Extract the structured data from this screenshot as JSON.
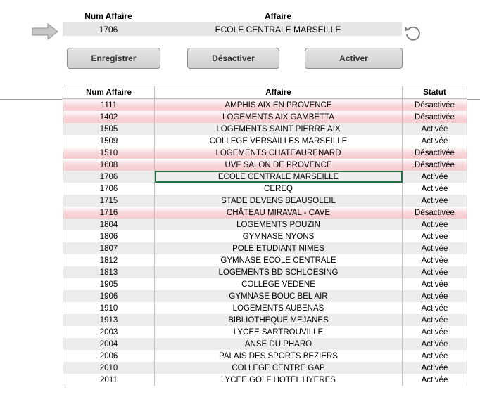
{
  "header": {
    "num_label": "Num Affaire",
    "affaire_label": "Affaire",
    "selected_num": "1706",
    "selected_affaire": "ECOLE CENTRALE MARSEILLE"
  },
  "icons": {
    "arrow": "arrow-right-icon",
    "refresh": "refresh-icon"
  },
  "buttons": {
    "save": "Enregistrer",
    "deactivate": "Désactiver",
    "activate": "Activer"
  },
  "colors": {
    "row_shade": "#ececec",
    "deactivated_tint": "#f6cbd0",
    "selection": "#217346"
  },
  "table": {
    "columns": [
      "Num Affaire",
      "Affaire",
      "Statut"
    ],
    "selected_row": 6,
    "rows": [
      {
        "num": "1111",
        "affaire": "AMPHIS AIX EN PROVENCE",
        "statut": "Désactivée"
      },
      {
        "num": "1402",
        "affaire": "LOGEMENTS AIX GAMBETTA",
        "statut": "Désactivée"
      },
      {
        "num": "1505",
        "affaire": "LOGEMENTS SAINT PIERRE AIX",
        "statut": "Activée"
      },
      {
        "num": "1509",
        "affaire": "COLLEGE VERSAILLES MARSEILLE",
        "statut": "Activée"
      },
      {
        "num": "1510",
        "affaire": "LOGEMENTS CHATEAURENARD",
        "statut": "Désactivée"
      },
      {
        "num": "1608",
        "affaire": "UVF SALON DE PROVENCE",
        "statut": "Désactivée"
      },
      {
        "num": "1706",
        "affaire": "ECOLE CENTRALE MARSEILLE",
        "statut": "Activée"
      },
      {
        "num": "1706",
        "affaire": "CEREQ",
        "statut": "Activée"
      },
      {
        "num": "1715",
        "affaire": "STADE DEVENS BEAUSOLEIL",
        "statut": "Activée"
      },
      {
        "num": "1716",
        "affaire": "CHÂTEAU MIRAVAL - CAVE",
        "statut": "Désactivée"
      },
      {
        "num": "1804",
        "affaire": "LOGEMENTS POUZIN",
        "statut": "Activée"
      },
      {
        "num": "1806",
        "affaire": "GYMNASE NYONS",
        "statut": "Activée"
      },
      {
        "num": "1807",
        "affaire": "POLE ETUDIANT NIMES",
        "statut": "Activée"
      },
      {
        "num": "1812",
        "affaire": "GYMNASE ECOLE CENTRALE",
        "statut": "Activée"
      },
      {
        "num": "1813",
        "affaire": "LOGEMENTS BD SCHLOESING",
        "statut": "Activée"
      },
      {
        "num": "1905",
        "affaire": "COLLEGE VEDENE",
        "statut": "Activée"
      },
      {
        "num": "1906",
        "affaire": "GYMNASE BOUC BEL AIR",
        "statut": "Activée"
      },
      {
        "num": "1910",
        "affaire": "LOGEMENTS AUBENAS",
        "statut": "Activée"
      },
      {
        "num": "1913",
        "affaire": "BIBLIOTHEQUE MEJANES",
        "statut": "Activée"
      },
      {
        "num": "2003",
        "affaire": "LYCEE SARTROUVILLE",
        "statut": "Activée"
      },
      {
        "num": "2004",
        "affaire": "ANSE DU PHARO",
        "statut": "Activée"
      },
      {
        "num": "2006",
        "affaire": "PALAIS DES SPORTS BEZIERS",
        "statut": "Activée"
      },
      {
        "num": "2010",
        "affaire": "COLLEGE CENTRE GAP",
        "statut": "Activée"
      },
      {
        "num": "2011",
        "affaire": "LYCEE GOLF HOTEL HYERES",
        "statut": "Activée"
      }
    ]
  }
}
